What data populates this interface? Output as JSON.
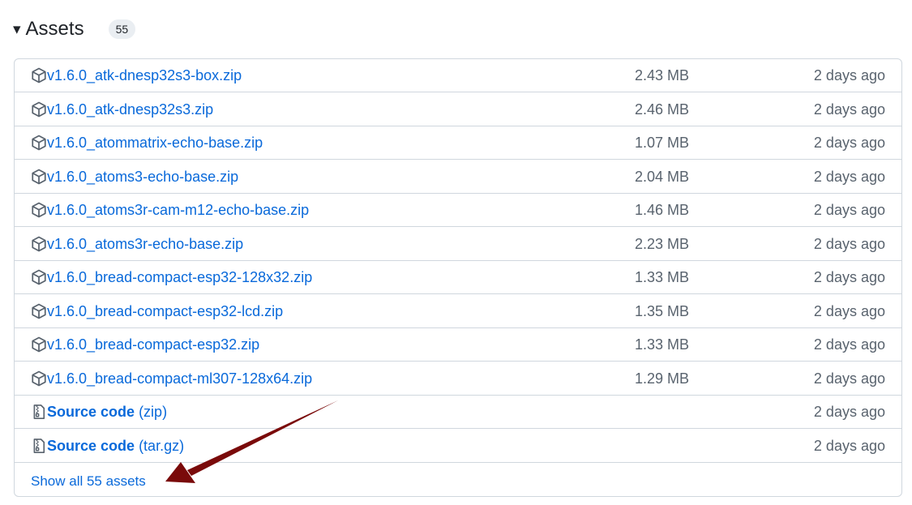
{
  "assets_header": {
    "caret": "▾",
    "title": "Assets",
    "count": "55"
  },
  "assets": [
    {
      "name": "v1.6.0_atk-dnesp32s3-box.zip",
      "size": "2.43 MB",
      "date": "2 days ago"
    },
    {
      "name": "v1.6.0_atk-dnesp32s3.zip",
      "size": "2.46 MB",
      "date": "2 days ago"
    },
    {
      "name": "v1.6.0_atommatrix-echo-base.zip",
      "size": "1.07 MB",
      "date": "2 days ago"
    },
    {
      "name": "v1.6.0_atoms3-echo-base.zip",
      "size": "2.04 MB",
      "date": "2 days ago"
    },
    {
      "name": "v1.6.0_atoms3r-cam-m12-echo-base.zip",
      "size": "1.46 MB",
      "date": "2 days ago"
    },
    {
      "name": "v1.6.0_atoms3r-echo-base.zip",
      "size": "2.23 MB",
      "date": "2 days ago"
    },
    {
      "name": "v1.6.0_bread-compact-esp32-128x32.zip",
      "size": "1.33 MB",
      "date": "2 days ago"
    },
    {
      "name": "v1.6.0_bread-compact-esp32-lcd.zip",
      "size": "1.35 MB",
      "date": "2 days ago"
    },
    {
      "name": "v1.6.0_bread-compact-esp32.zip",
      "size": "1.33 MB",
      "date": "2 days ago"
    },
    {
      "name": "v1.6.0_bread-compact-ml307-128x64.zip",
      "size": "1.29 MB",
      "date": "2 days ago"
    }
  ],
  "source_code": [
    {
      "label": "Source code",
      "ext": "(zip)",
      "date": "2 days ago"
    },
    {
      "label": "Source code",
      "ext": "(tar.gz)",
      "date": "2 days ago"
    }
  ],
  "show_all_label": "Show all 55 assets",
  "icons": {
    "asset": "package-icon",
    "source": "file-zip-icon"
  },
  "colors": {
    "link": "#0969da",
    "muted": "#59636e",
    "border": "#d0d7de",
    "annotation_arrow": "#7a0a0a"
  }
}
